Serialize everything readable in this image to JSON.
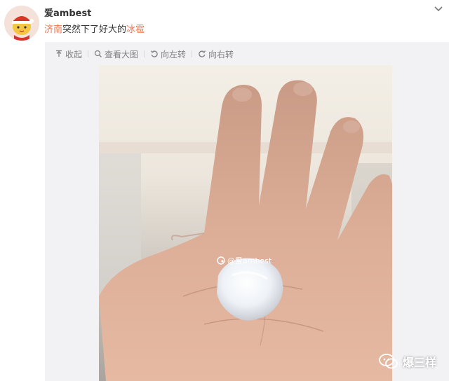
{
  "post": {
    "username": "爱ambest",
    "text_parts": [
      {
        "text": "济南",
        "type": "link"
      },
      {
        "text": "突然下了好大的",
        "type": "text"
      },
      {
        "text": "冰雹",
        "type": "link"
      }
    ]
  },
  "toolbar": {
    "collapse_label": "收起",
    "view_large_label": "查看大图",
    "rotate_left_label": "向左转",
    "rotate_right_label": "向右转"
  },
  "photo": {
    "watermark_text": "@爱ambest"
  },
  "wechat_watermark": {
    "label": "爆三样"
  },
  "icons": {
    "menu": "chevron-down-icon",
    "collapse": "collapse-icon",
    "view_large": "search-icon",
    "rotate_left": "rotate-left-icon",
    "rotate_right": "rotate-right-icon",
    "wechat": "wechat-icon"
  },
  "colors": {
    "link": "#eb7350",
    "panel_bg": "#f2f2f5"
  }
}
